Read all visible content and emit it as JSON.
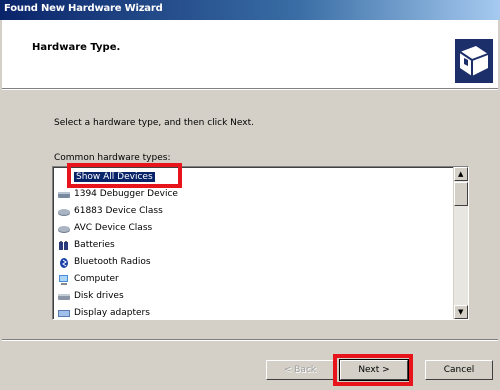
{
  "window": {
    "title": "Found New Hardware Wizard"
  },
  "header": {
    "title": "Hardware Type.",
    "icon": "hardware-wizard-icon"
  },
  "instruction": "Select a hardware type, and then click Next.",
  "list_label": "Common hardware types:",
  "list_items": [
    {
      "label": "Show All Devices",
      "icon": "show-all-icon",
      "selected": true
    },
    {
      "label": "1394 Debugger Device",
      "icon": "debugger-device-icon"
    },
    {
      "label": "61883 Device Class",
      "icon": "device-class-icon"
    },
    {
      "label": "AVC Device Class",
      "icon": "device-class-icon"
    },
    {
      "label": "Batteries",
      "icon": "battery-icon"
    },
    {
      "label": "Bluetooth Radios",
      "icon": "bluetooth-icon"
    },
    {
      "label": "Computer",
      "icon": "computer-icon"
    },
    {
      "label": "Disk drives",
      "icon": "disk-drive-icon"
    },
    {
      "label": "Display adapters",
      "icon": "display-adapter-icon"
    }
  ],
  "buttons": {
    "back": "< Back",
    "next": "Next >",
    "cancel": "Cancel"
  },
  "colors": {
    "highlight_box": "#e8141c",
    "selection": "#0a246a"
  }
}
